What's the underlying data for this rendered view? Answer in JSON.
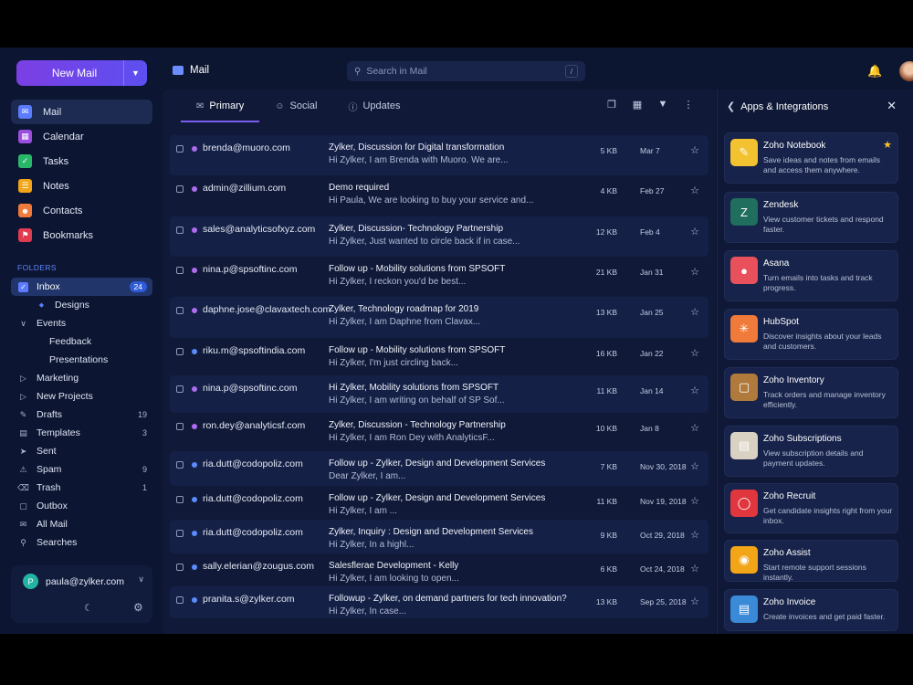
{
  "sidebar": {
    "new_mail_label": "New Mail",
    "nav": [
      {
        "label": "Mail",
        "icon": "mail-icon",
        "color": "#5b7cff",
        "active": true
      },
      {
        "label": "Calendar",
        "icon": "calendar-icon",
        "color": "#9b4de0"
      },
      {
        "label": "Tasks",
        "icon": "tasks-icon",
        "color": "#29b869"
      },
      {
        "label": "Notes",
        "icon": "notes-icon",
        "color": "#f2a516"
      },
      {
        "label": "Contacts",
        "icon": "contacts-icon",
        "color": "#ee7b3c"
      },
      {
        "label": "Bookmarks",
        "icon": "bookmarks-icon",
        "color": "#e03b4f"
      }
    ],
    "folders_title": "FOLDERS",
    "folders": [
      {
        "label": "Inbox",
        "badge": "24"
      },
      {
        "label": "Designs"
      },
      {
        "label": "Events"
      },
      {
        "label": "Feedback"
      },
      {
        "label": "Presentations"
      },
      {
        "label": "Marketing"
      },
      {
        "label": "New Projects"
      },
      {
        "label": "Drafts",
        "count": "19"
      },
      {
        "label": "Templates",
        "count": "3"
      },
      {
        "label": "Sent"
      },
      {
        "label": "Spam",
        "count": "9"
      },
      {
        "label": "Trash",
        "count": "1"
      },
      {
        "label": "Outbox"
      },
      {
        "label": "All Mail"
      },
      {
        "label": "Searches"
      }
    ],
    "user": {
      "initial": "P",
      "email": "paula@zylker.com"
    }
  },
  "topbar": {
    "title": "Mail",
    "search_placeholder": "Search in Mail",
    "search_shortcut": "/"
  },
  "tabs": [
    {
      "label": "Primary",
      "icon": "envelope-icon"
    },
    {
      "label": "Social",
      "icon": "people-icon"
    },
    {
      "label": "Updates",
      "icon": "info-icon"
    }
  ],
  "emails": [
    {
      "sender": "brenda@muoro.com",
      "subject": "Zylker, Discussion for Digital transformation",
      "preview": "Hi Zylker, I am Brenda with Muoro. We are...",
      "size": "5 KB",
      "date": "Mar 7",
      "dot": "#b06cf0"
    },
    {
      "sender": "admin@zillium.com",
      "subject": "Demo required",
      "preview": "Hi Paula, We are looking to buy your service and...",
      "size": "4 KB",
      "date": "Feb 27",
      "dot": "#b06cf0"
    },
    {
      "sender": "sales@analyticsofxyz.com",
      "subject": "Zylker, Discussion- Technology Partnership",
      "preview": "Hi Zylker, Just wanted to circle back if in case...",
      "size": "12 KB",
      "date": "Feb 4",
      "dot": "#b06cf0"
    },
    {
      "sender": "nina.p@spsoftinc.com",
      "subject": "Follow up - Mobility solutions from SPSOFT",
      "preview": "Hi Zylker, I reckon you'd be best...",
      "size": "21 KB",
      "date": "Jan 31",
      "dot": "#b06cf0"
    },
    {
      "sender": "daphne.jose@clavaxtech.com",
      "subject": "Zylker, Technology roadmap for 2019",
      "preview": "Hi Zylker, I am Daphne from Clavax...",
      "size": "13 KB",
      "date": "Jan 25",
      "dot": "#b06cf0"
    },
    {
      "sender": "riku.m@spsoftindia.com",
      "subject": "Follow up - Mobility solutions from SPSOFT",
      "preview": "Hi Zylker, I'm just circling back...",
      "size": "16 KB",
      "date": "Jan 22",
      "dot": "#5b8cff"
    },
    {
      "sender": "nina.p@spsoftinc.com",
      "subject": "Hi Zylker, Mobility solutions from SPSOFT",
      "preview": "Hi Zylker, I am writing on behalf of SP Sof...",
      "size": "11 KB",
      "date": "Jan 14",
      "dot": "#b06cf0"
    },
    {
      "sender": "ron.dey@analyticsf.com",
      "subject": "Zylker, Discussion - Technology Partnership",
      "preview": "Hi Zylker, I am Ron Dey with AnalyticsF...",
      "size": "10 KB",
      "date": "Jan 8",
      "dot": "#b06cf0"
    },
    {
      "sender": "ria.dutt@codopoliz.com",
      "subject": "Follow up - Zylker, Design and Development Services",
      "preview": "Dear Zylker, I am...",
      "size": "7 KB",
      "date": "Nov 30, 2018",
      "dot": "#5b8cff"
    },
    {
      "sender": "ria.dutt@codopoliz.com",
      "subject": "Follow up - Zylker, Design and Development Services",
      "preview": "Hi Zylker, I am ...",
      "size": "11 KB",
      "date": "Nov 19, 2018",
      "dot": "#5b8cff"
    },
    {
      "sender": "ria.dutt@codopoliz.com",
      "subject": "Zylker, Inquiry : Design and Development Services",
      "preview": "Hi Zylker, In a highl...",
      "size": "9 KB",
      "date": "Oct 29, 2018",
      "dot": "#5b8cff"
    },
    {
      "sender": "sally.elerian@zougus.com",
      "subject": "Salesflerae Development - Kelly",
      "preview": "Hi Zylker, I am looking to open...",
      "size": "6 KB",
      "date": "Oct 24, 2018",
      "dot": "#5b8cff"
    },
    {
      "sender": "pranita.s@zylker.com",
      "subject": "Followup - Zylker, on demand partners for tech innovation?",
      "preview": "Hi Zylker, In case...",
      "size": "13 KB",
      "date": "Sep 25, 2018",
      "dot": "#5b8cff"
    }
  ],
  "apps_panel": {
    "title": "Apps & Integrations",
    "apps": [
      {
        "name": "Zoho Notebook",
        "desc": "Save ideas and notes from emails and access them anywhere.",
        "color": "#f2c230",
        "icon": "notebook-icon",
        "favorite": true
      },
      {
        "name": "Zendesk",
        "desc": "View customer tickets and respond faster.",
        "color": "#1f6e5e",
        "icon": "zendesk-icon"
      },
      {
        "name": "Asana",
        "desc": "Turn emails into tasks and track progress.",
        "color": "#e8505b",
        "icon": "asana-icon"
      },
      {
        "name": "HubSpot",
        "desc": "Discover insights about your leads and customers.",
        "color": "#f07a3a",
        "icon": "hubspot-icon"
      },
      {
        "name": "Zoho Inventory",
        "desc": "Track orders and manage inventory efficiently.",
        "color": "#b07a3c",
        "icon": "inventory-icon"
      },
      {
        "name": "Zoho Subscriptions",
        "desc": "View subscription details and payment updates.",
        "color": "#d9d1c2",
        "icon": "subscriptions-icon"
      },
      {
        "name": "Zoho Recruit",
        "desc": "Get candidate insights right from your inbox.",
        "color": "#e0363e",
        "icon": "recruit-icon"
      },
      {
        "name": "Zoho Assist",
        "desc": "Start remote support sessions instantly.",
        "color": "#f2a516",
        "icon": "assist-icon"
      },
      {
        "name": "Zoho Invoice",
        "desc": "Create invoices and get paid faster.",
        "color": "#3a8ad8",
        "icon": "invoice-icon"
      }
    ]
  }
}
